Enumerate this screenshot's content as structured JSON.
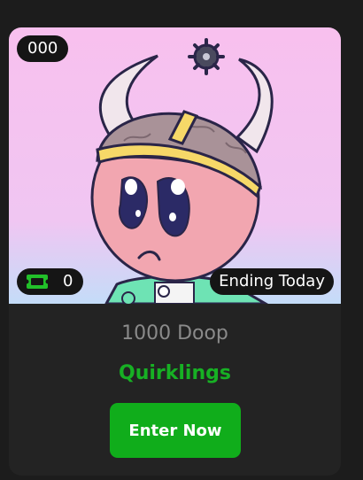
{
  "card": {
    "id_badge": "000",
    "ticket_count": "0",
    "status": "Ending Today",
    "price": "1000 Doop",
    "collection": "Quirklings",
    "enter_label": "Enter Now"
  },
  "colors": {
    "page_bg": "#1c1c1c",
    "card_bg": "#232323",
    "pill_bg": "#151515",
    "accent_green": "#10ad1b",
    "price_grey": "#8a8a8a",
    "ticket_icon": "#22c02a"
  },
  "icons": {
    "ticket": "ticket-icon"
  }
}
